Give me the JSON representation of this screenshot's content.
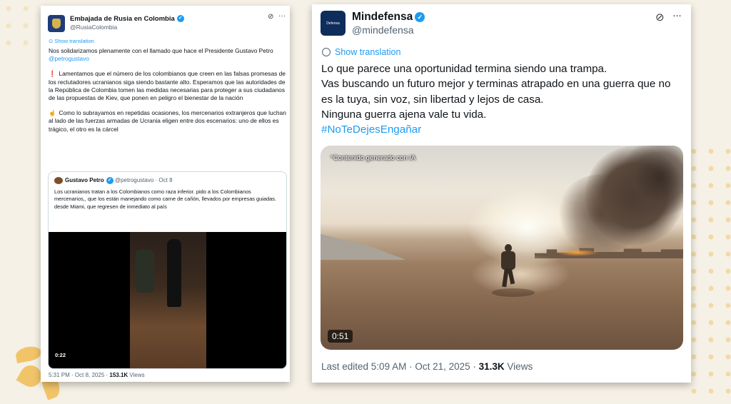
{
  "left_tweet": {
    "author_name": "Embajada de Rusia en Colombia",
    "handle": "@RusiaColombia",
    "show_translation": "Show translation",
    "text_p1": "Nos solidarizamos plenamente con el llamado que hace el Presidente Gustavo Petro ",
    "text_p1_mention": "@petrogustavo",
    "bullet1": "❗",
    "text_p2": "Lamentamos que el número de los colombianos que creen en las falsas promesas de los reclutadores ucranianos siga siendo bastante alto. Esperamos que las autoridades de la República de Colombia tomen las medidas necesarias para proteger a sus ciudadanos de las propuestas de Kiev, que ponen en peligro el bienestar de la nación",
    "bullet2": "☝",
    "text_p3": "Como lo subrayamos en repetidas ocasiones, los mercenarios extranjeros que luchan al lado de las fuerzas armadas de Ucrania eligen entre dos escenarios: uno de ellos es trágico, el otro es la cárcel",
    "quote": {
      "author_name": "Gustavo Petro",
      "handle": "@petrogustavo",
      "date": "· Oct 8",
      "text": "Los ucranianos tratan a los Colombianos como raza inferior. pido a los Colombianos mercenarios,, que los están manejando como carne de cañón, llevados por empresas  guiadas. desde Miami, que regresen de inmediato al país",
      "video_time": "0:22"
    },
    "footer_time": "5:31 PM · Oct 8, 2025 · ",
    "footer_views_count": "153.1K",
    "footer_views_label": " Views"
  },
  "right_tweet": {
    "avatar_text": "Defensa",
    "author_name": "Mindefensa",
    "handle": "@mindefensa",
    "show_translation": "Show translation",
    "lines": [
      "Lo que parece una oportunidad termina siendo una trampa.",
      "Vas buscando un futuro mejor y terminas atrapado en una guerra que no",
      "es la tuya, sin voz, sin libertad y lejos de casa.",
      "Ninguna guerra ajena vale tu vida."
    ],
    "hashtag": "#NoTeDejesEngañar",
    "media_label": "*Contenido generado con IA",
    "video_time": "0:51",
    "footer_edited": "Last edited 5:09 AM · Oct 21, 2025 · ",
    "footer_views_count": "31.3K",
    "footer_views_label": " Views"
  },
  "icons": {
    "grok": "⊘",
    "more": "···",
    "verified": "✓"
  }
}
